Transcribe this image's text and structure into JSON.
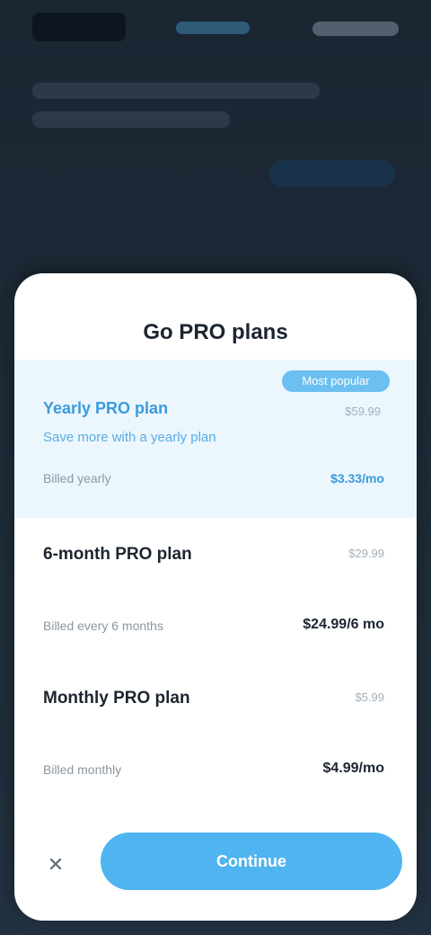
{
  "status": {
    "logo_label": "",
    "right_label": ""
  },
  "sheet": {
    "title": "Go PRO plans",
    "highlight": {
      "badge": "Most popular",
      "title": "Yearly PRO plan",
      "note": "Save more with a yearly plan",
      "previous_price": "$59.99",
      "footer_left": "Billed yearly",
      "footer_right": "$3.33/mo"
    },
    "plans": [
      {
        "title": "6-month PRO plan",
        "old_price": "$29.99",
        "sub": "Billed every 6 months",
        "price": "$24.99/6 mo"
      },
      {
        "title": "Monthly PRO plan",
        "old_price": "$5.99",
        "sub": "Billed monthly",
        "price": "$4.99/mo"
      }
    ],
    "close_icon": "close-icon",
    "cta_label": "Continue"
  }
}
